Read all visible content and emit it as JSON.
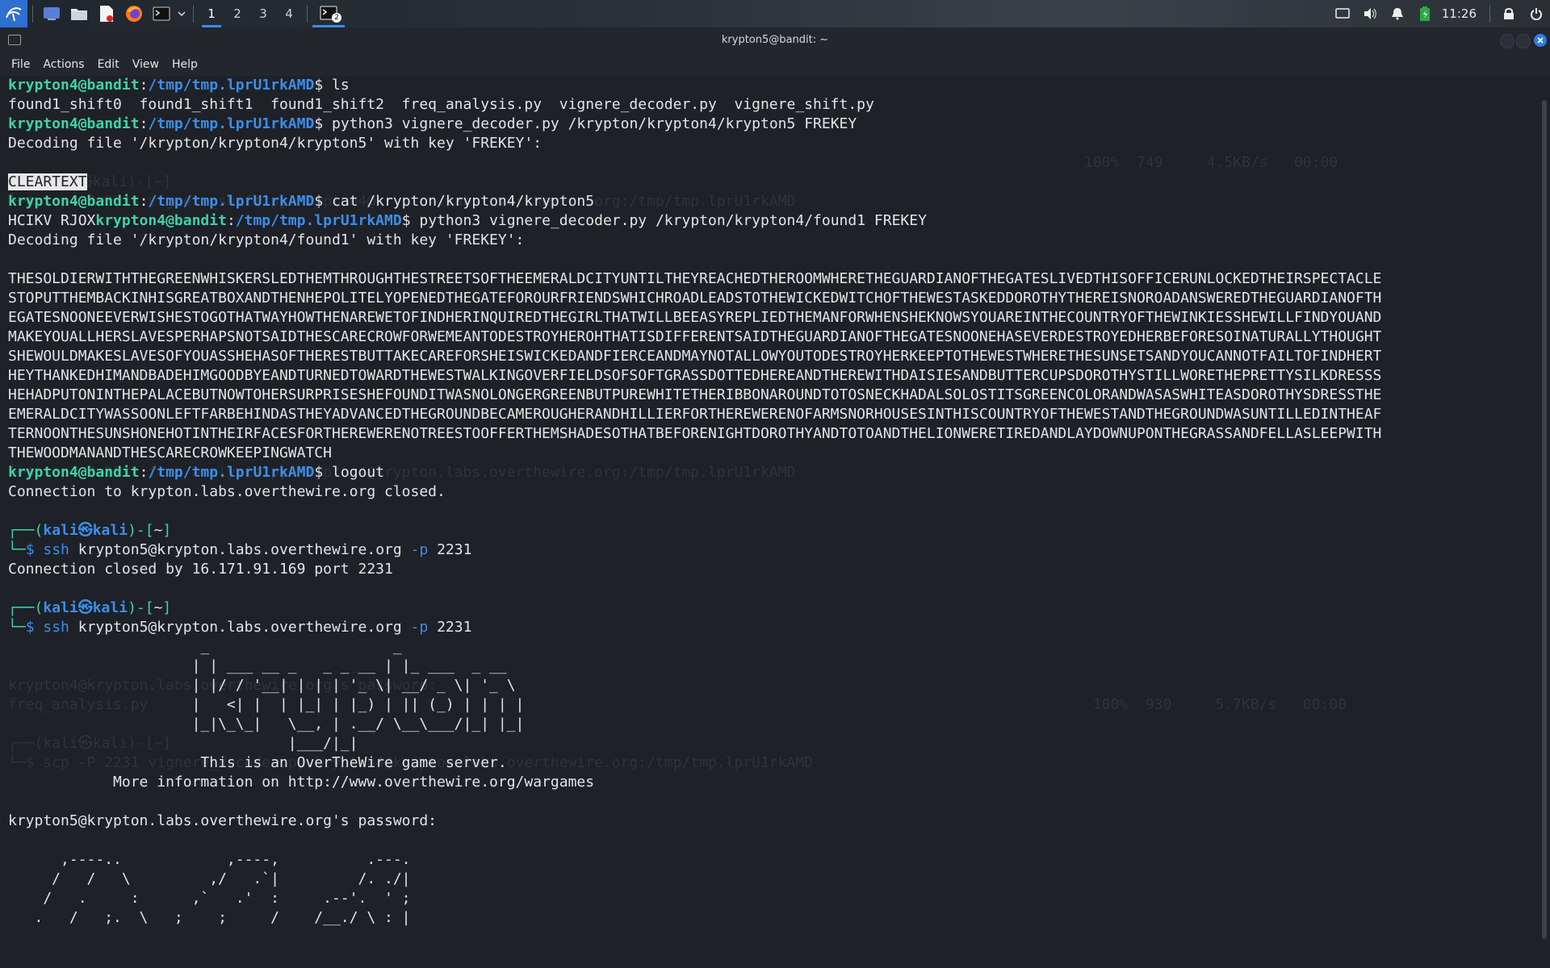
{
  "taskbar": {
    "workspaces": [
      "1",
      "2",
      "3",
      "4"
    ],
    "active_workspace": "1",
    "terminal_badge": "2",
    "clock": "11:26"
  },
  "window": {
    "title": "krypton5@bandit: ~",
    "menu": [
      "File",
      "Actions",
      "Edit",
      "View",
      "Help"
    ]
  },
  "terminal": {
    "lines": [
      {
        "prompt": [
          "krypton4@bandit",
          ":",
          "/tmp/tmp.lprU1rkAMD",
          "$ "
        ],
        "cmd": "ls"
      },
      {
        "text": "found1_shift0  found1_shift1  found1_shift2  freq_analysis.py  vignere_decoder.py  vignere_shift.py"
      },
      {
        "prompt": [
          "krypton4@bandit",
          ":",
          "/tmp/tmp.lprU1rkAMD",
          "$ "
        ],
        "cmd": "python3 vignere_decoder.py /krypton/krypton4/krypton5 FREKEY"
      },
      {
        "text": "Decoding file '/krypton/krypton4/krypton5' with key 'FREKEY':"
      },
      {
        "text": ""
      },
      {
        "selected": "CLEARTEXT"
      },
      {
        "prompt": [
          "krypton4@bandit",
          ":",
          "/tmp/tmp.lprU1rkAMD",
          "$ "
        ],
        "cmd": "cat /krypton/krypton4/krypton5"
      },
      {
        "pre": "HCIKV RJOX",
        "prompt": [
          "krypton4@bandit",
          ":",
          "/tmp/tmp.lprU1rkAMD",
          "$ "
        ],
        "cmd": "python3 vignere_decoder.py /krypton/krypton4/found1 FREKEY"
      },
      {
        "text": "Decoding file '/krypton/krypton4/found1' with key 'FREKEY':"
      },
      {
        "text": ""
      },
      {
        "text": "THESOLDIERWITHTHEGREENWHISKERSLEDTHEMTHROUGHTHESTREETSOFTHEEMERALDCITYUNTILTHEYREACHEDTHEROOMWHERETHEGUARDIANOFTHEGATESLIVEDTHISOFFICERUNLOCKEDTHEIRSPECTACLE"
      },
      {
        "text": "STOPUTTHEMBACKINHISGREATBOXANDTHENHEPOLITELYOPENEDTHEGATEFOROURFRIENDSWHICHROADLEADSTOTHEWICKEDWITCHOFTHEWESTASKEDDOROTHYTHEREISNOROADANSWEREDTHEGUARDIANOFTH"
      },
      {
        "text": "EGATESNOONEEVERWISHESTOGOTHATWAYHOWTHENAREWETOFINDHERINQUIREDTHEGIRLTHATWILLBEEASYREPLIEDTHEMANFORWHENSHEKNOWSYOUAREINTHECOUNTRYOFTHEWINKIESSHEWILLFINDYOUAND"
      },
      {
        "text": "MAKEYOUALLHERSLAVESPERHAPSNOTSAIDTHESCARECROWFORWEMEANTODESTROYHEROHTHATISDIFFERENTSAIDTHEGUARDIANOFTHEGATESNOONEHASEVERDESTROYEDHERBEFORESOINATURALLYTHOUGHT"
      },
      {
        "text": "SHEWOULDMAKESLAVESOFYOUASSHEHASOFTHERESTBUTTAKECAREFORSHEISWICKEDANDFIERCEANDMAYNOTALLOWYOUTODESTROYHERKEEPTOTHEWESTWHERETHESUNSETSANDYOUCANNOTFAILTOFINDHERT"
      },
      {
        "text": "HEYTHANKEDHIMANDBADEHIMGOODBYEANDTURNEDTOWARDTHEWESTWALKINGOVERFIELDSOFSOFTGRASSDOTTEDHEREANDTHEREWITHDAISIESANDBUTTERCUPSDOROTHYSTILLWORETHEPRETTYSILKDRESSS"
      },
      {
        "text": "HEHADPUTONINTHEPALACEBUTNOWTOHERSURPRISESHEFOUNDITWASNOLONGERGREENBUTPUREWHITETHERIBBONAROUNDTOTOSNECKHADALSOLOSTITSGREENCOLORANDWASASWHITEASDOROTHYSDRESSTHE"
      },
      {
        "text": "EMERALDCITYWASSOONLEFTFARBEHINDASTHEYADVANCEDTHEGROUNDBECAMEROUGHERANDHILLIERFORTHEREWERENOFARMSNORHOUSESINTHISCOUNTRYOFTHEWESTANDTHEGROUNDWASUNTILLEDINTHEAF"
      },
      {
        "text": "TERNOONTHESUNSHONEHOTINTHEIRFACESFORTHEREWERENOTREESTOOFFERTHEMSHADESOTHATBEFORENIGHTDOROTHYANDTOTOANDTHELIONWERETIREDANDLAYDOWNUPONTHEGRASSANDFELLASLEEPWITH"
      },
      {
        "text": "THEWOODMANANDTHESCARECROWKEEPINGWATCH"
      },
      {
        "prompt": [
          "krypton4@bandit",
          ":",
          "/tmp/tmp.lprU1rkAMD",
          "$ "
        ],
        "cmd": "logout"
      },
      {
        "text": "Connection to krypton.labs.overthewire.org closed."
      },
      {
        "text": ""
      },
      {
        "kali_top": [
          "┌──(",
          "kali㉿kali",
          ")-[",
          "~",
          "]"
        ]
      },
      {
        "kali_cmd": [
          "└─",
          "$ ",
          "ssh ",
          "krypton5@krypton.labs.overthewire.org ",
          "-p ",
          "2231"
        ]
      },
      {
        "text": "Connection closed by 16.171.91.169 port 2231"
      },
      {
        "text": ""
      },
      {
        "kali_top": [
          "┌──(",
          "kali㉿kali",
          ")-[",
          "~",
          "]"
        ]
      },
      {
        "kali_cmd": [
          "└─",
          "$ ",
          "ssh ",
          "krypton5@krypton.labs.overthewire.org ",
          "-p ",
          "2231"
        ]
      },
      {
        "text": "                      _                     _"
      },
      {
        "text": "                     | | ___ __ _   _ _ __ | |_ ___  _ __"
      },
      {
        "text": "                     | |/ / '__| | | | '_ \\| __/ _ \\| '_ \\"
      },
      {
        "text": "                     |   <| |  | |_| | |_) | || (_) | | | |"
      },
      {
        "text": "                     |_|\\_\\_|   \\__, | .__/ \\__\\___/|_| |_|"
      },
      {
        "text": "                                |___/|_|"
      },
      {
        "text": "                      This is an OverTheWire game server."
      },
      {
        "text": "            More information on http://www.overthewire.org/wargames"
      },
      {
        "text": ""
      },
      {
        "text": "krypton5@krypton.labs.overthewire.org's password:"
      },
      {
        "text": ""
      },
      {
        "text": "      ,----..            ,----,          .---."
      },
      {
        "text": "     /   /   \\         ,/   .`|         /. ./|"
      },
      {
        "text": "    /   .     :      ,`   .'  :     .--'.  ' ;"
      },
      {
        "text": "   .   /   ;.  \\   ;    ;     /    /__./ \\ : |"
      }
    ],
    "ghost_lines": [
      "",
      "",
      "",
      "",
      "                                                                                                                           100%  749     4.5KB/s   00:00",
      "┌──(kali㉿kali)-[~]",
      "└─$ scp -P 2231 vignere_shift.py krypton4@krypton.labs.overthewire.org:/tmp/tmp.lprU1rkAMD",
      "",
      "",
      "",
      "",
      "",
      "",
      "",
      "",
      "",
      "",
      "",
      "",
      "",
      "└─$ scp -P 2231 freq_analysis.py krypton4@krypton.labs.overthewire.org:/tmp/tmp.lprU1rkAMD",
      "",
      "",
      "",
      "",
      "",
      "",
      "",
      "",
      "",
      "",
      "krypton4@krypton.labs.overthewire.org's password:",
      "freq_analysis.py                                                                                                            100%  930     5.7KB/s   00:00",
      "",
      "┌──(kali㉿kali)-[~]",
      "└─$ scp -P 2231 vignere_decoder.py krypton4@krypton.labs.overthewire.org:/tmp/tmp.lprU1rkAMD"
    ]
  }
}
